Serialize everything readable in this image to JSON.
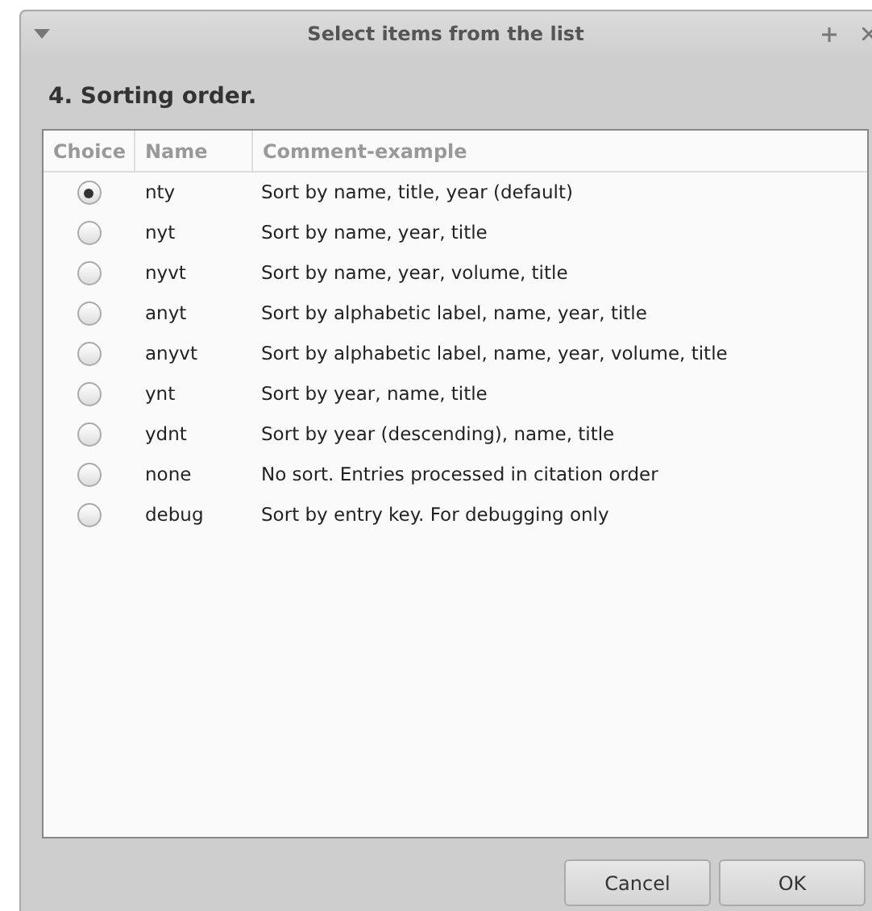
{
  "window": {
    "title": "Select items from the list"
  },
  "heading": "4. Sorting order.",
  "table": {
    "columns": [
      "Choice",
      "Name",
      "Comment-example"
    ],
    "rows": [
      {
        "name": "nty",
        "comment": "Sort by name, title, year (default)",
        "selected": true
      },
      {
        "name": "nyt",
        "comment": "Sort by name, year, title",
        "selected": false
      },
      {
        "name": "nyvt",
        "comment": "Sort by name, year, volume, title",
        "selected": false
      },
      {
        "name": "anyt",
        "comment": "Sort by alphabetic label, name, year, title",
        "selected": false
      },
      {
        "name": "anyvt",
        "comment": "Sort by alphabetic label, name, year, volume, title",
        "selected": false
      },
      {
        "name": "ynt",
        "comment": "Sort by year, name, title",
        "selected": false
      },
      {
        "name": "ydnt",
        "comment": "Sort by year (descending), name, title",
        "selected": false
      },
      {
        "name": "none",
        "comment": "No sort. Entries processed in citation order",
        "selected": false
      },
      {
        "name": "debug",
        "comment": "Sort by entry key. For debugging only",
        "selected": false
      }
    ]
  },
  "buttons": [
    "Cancel",
    "OK"
  ]
}
